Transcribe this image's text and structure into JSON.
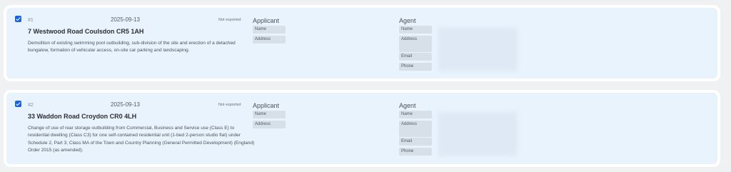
{
  "applications": [
    {
      "index": "#1",
      "date": "2025-09-13",
      "status": "Not exported",
      "address": "7 Westwood Road Coulsdon CR5 1AH",
      "description": "Demolition of existing swimming pool outbuilding, sub-division of the site and erection of a detached bungalow, formation of vehicular access, on-site car parking and landscaping.",
      "applicant_heading": "Applicant",
      "applicant_fields": [
        "Name",
        "Address"
      ],
      "agent_heading": "Agent",
      "agent_fields": [
        "Name",
        "Address",
        "Email",
        "Phone"
      ]
    },
    {
      "index": "#2",
      "date": "2025-09-13",
      "status": "Not exported",
      "address": "33 Waddon Road Croydon CR0 4LH",
      "description": "Change of use of rear storage outbuilding from Commercial, Business and Service use (Class E) to residential dwelling (Class C3) for one self-contained residential unit (1-bed 2-person studio flat) under Schedule 2, Part 3, Class MA of the Town and Country Planning (General Permitted Development) (England) Order 2015 (as amended).",
      "applicant_heading": "Applicant",
      "applicant_fields": [
        "Name",
        "Address"
      ],
      "agent_heading": "Agent",
      "agent_fields": [
        "Name",
        "Address",
        "Email",
        "Phone"
      ]
    }
  ],
  "colors": {
    "page_background": "#eff1f3",
    "card_background": "#e9f3fd",
    "checkbox": "#1a64d9",
    "field_label_background": "#d7dfe8"
  },
  "icons": {
    "checkbox": "checked-checkbox-icon"
  }
}
